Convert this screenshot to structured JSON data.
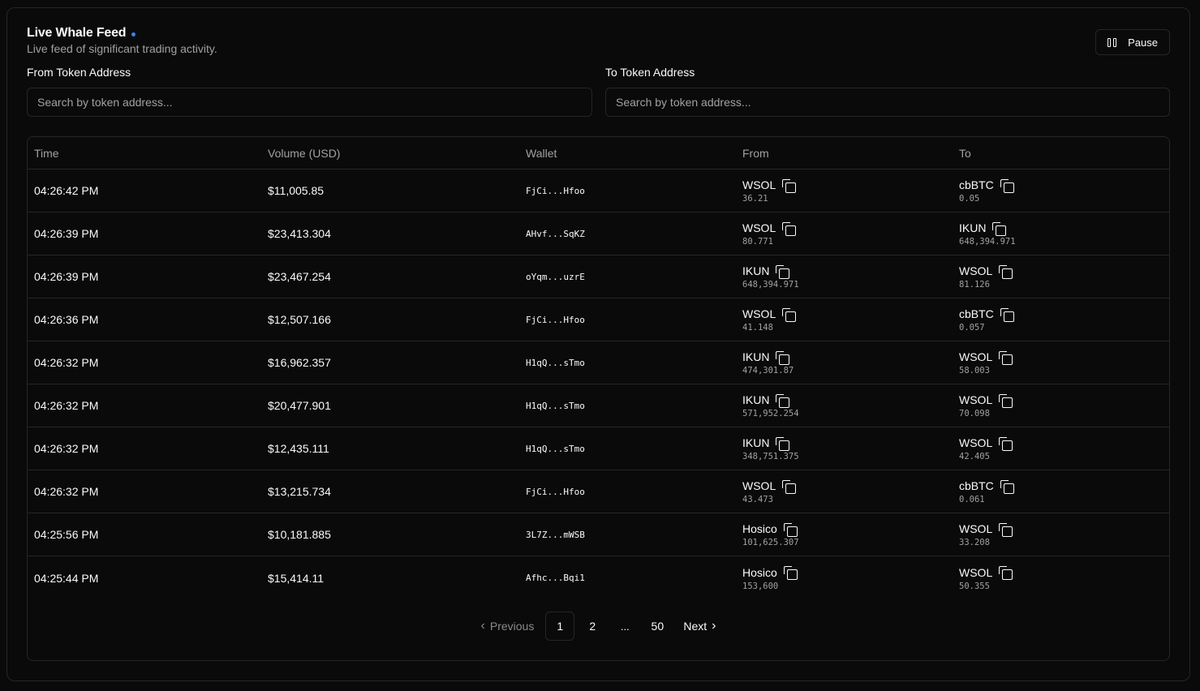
{
  "header": {
    "title": "Live Whale Feed",
    "subtitle": "Live feed of significant trading activity.",
    "pause_label": "Pause",
    "live_dot_color": "#3b82f6"
  },
  "filters": {
    "from_label": "From Token Address",
    "from_placeholder": "Search by token address...",
    "to_label": "To Token Address",
    "to_placeholder": "Search by token address..."
  },
  "table": {
    "headers": {
      "time": "Time",
      "volume": "Volume (USD)",
      "wallet": "Wallet",
      "from": "From",
      "to": "To"
    },
    "rows": [
      {
        "time": "04:26:42 PM",
        "volume": "$11,005.85",
        "wallet": "FjCi...Hfoo",
        "from_token": "WSOL",
        "from_amount": "36.21",
        "to_token": "cbBTC",
        "to_amount": "0.05"
      },
      {
        "time": "04:26:39 PM",
        "volume": "$23,413.304",
        "wallet": "AHvf...SqKZ",
        "from_token": "WSOL",
        "from_amount": "80.771",
        "to_token": "IKUN",
        "to_amount": "648,394.971"
      },
      {
        "time": "04:26:39 PM",
        "volume": "$23,467.254",
        "wallet": "oYqm...uzrE",
        "from_token": "IKUN",
        "from_amount": "648,394.971",
        "to_token": "WSOL",
        "to_amount": "81.126"
      },
      {
        "time": "04:26:36 PM",
        "volume": "$12,507.166",
        "wallet": "FjCi...Hfoo",
        "from_token": "WSOL",
        "from_amount": "41.148",
        "to_token": "cbBTC",
        "to_amount": "0.057"
      },
      {
        "time": "04:26:32 PM",
        "volume": "$16,962.357",
        "wallet": "H1qQ...sTmo",
        "from_token": "IKUN",
        "from_amount": "474,301.87",
        "to_token": "WSOL",
        "to_amount": "58.003"
      },
      {
        "time": "04:26:32 PM",
        "volume": "$20,477.901",
        "wallet": "H1qQ...sTmo",
        "from_token": "IKUN",
        "from_amount": "571,952.254",
        "to_token": "WSOL",
        "to_amount": "70.098"
      },
      {
        "time": "04:26:32 PM",
        "volume": "$12,435.111",
        "wallet": "H1qQ...sTmo",
        "from_token": "IKUN",
        "from_amount": "348,751.375",
        "to_token": "WSOL",
        "to_amount": "42.405"
      },
      {
        "time": "04:26:32 PM",
        "volume": "$13,215.734",
        "wallet": "FjCi...Hfoo",
        "from_token": "WSOL",
        "from_amount": "43.473",
        "to_token": "cbBTC",
        "to_amount": "0.061"
      },
      {
        "time": "04:25:56 PM",
        "volume": "$10,181.885",
        "wallet": "3L7Z...mWSB",
        "from_token": "Hosico",
        "from_amount": "101,625.307",
        "to_token": "WSOL",
        "to_amount": "33.208"
      },
      {
        "time": "04:25:44 PM",
        "volume": "$15,414.11",
        "wallet": "Afhc...Bqi1",
        "from_token": "Hosico",
        "from_amount": "153,600",
        "to_token": "WSOL",
        "to_amount": "50.355"
      }
    ]
  },
  "pagination": {
    "previous_label": "Previous",
    "next_label": "Next",
    "pages": [
      "1",
      "2"
    ],
    "ellipsis": "...",
    "last_page": "50",
    "current_page": "1"
  }
}
